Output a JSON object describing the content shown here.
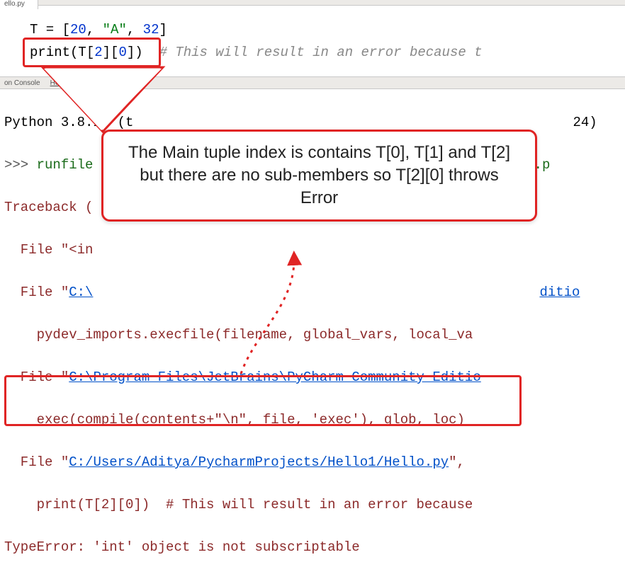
{
  "tabs": {
    "editor": "ello.py"
  },
  "code": {
    "line1_pre": "T = [",
    "line1_n1": "20",
    "line1_c1": ", ",
    "line1_str": "\"A\"",
    "line1_c2": ", ",
    "line1_n2": "32",
    "line1_post": "]",
    "line2_fn": "print",
    "line2_open": "(T[",
    "line2_i1": "2",
    "line2_mid": "][",
    "line2_i2": "0",
    "line2_close": "])",
    "line2_comment": "# This will result in an error because t"
  },
  "panel": {
    "tab1": "on Console",
    "tab2": "Hello"
  },
  "console": {
    "l1a": "Python 3.8.1  (t",
    "l1b": "24)",
    "l2a": ">>> ",
    "l2b": "runfile",
    "l2c": "llo.p",
    "l3": "Traceback (",
    "l4a": "  File ",
    "l4b": "\"<in",
    "l5a": "  File ",
    "l5b": "\"",
    "l5c": "C:\\",
    "l5d": "ditio",
    "l6": "    pydev_imports.execfile(filename, global_vars, local_va",
    "l7a": "  File ",
    "l7b": "\"",
    "l7c": "C:\\Program Files\\JetBrains\\PyCharm Community Editio",
    "l8": "    exec(compile(contents+\"\\n\", file, 'exec'), glob, loc)",
    "l9a": "  File ",
    "l9b": "\"",
    "l9c": "C:/Users/Aditya/PycharmProjects/Hello1/Hello.py",
    "l9d": "\", ",
    "l10": "    print(T[2][0])  # This will result in an error because ",
    "l11": "TypeError: 'int' object is not subscriptable"
  },
  "callout": {
    "text": "The Main tuple index is contains T[0], T[1] and T[2] but there are no sub-members so T[2][0] throws Error"
  }
}
